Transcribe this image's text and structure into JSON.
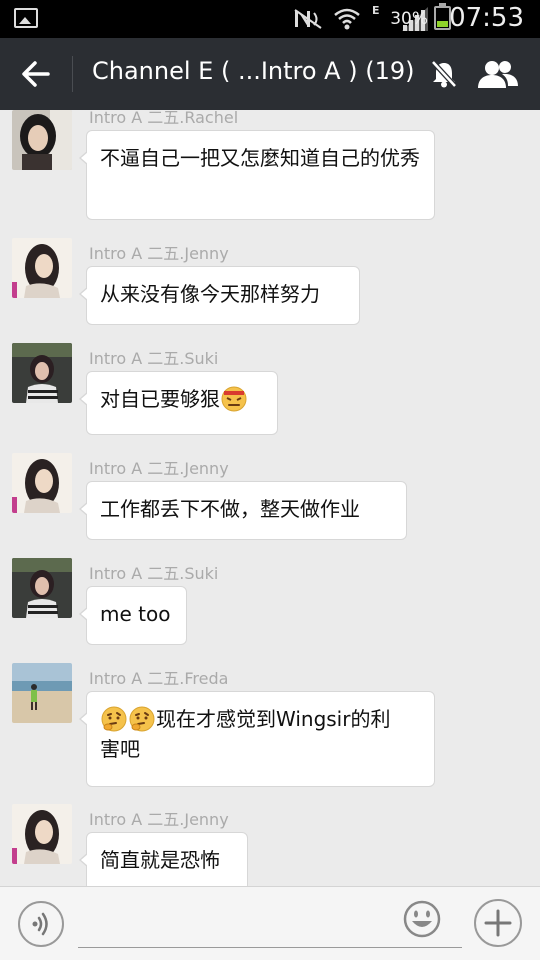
{
  "status_bar": {
    "battery": "30%",
    "network": "E",
    "time": "07:53",
    "battery_level": 0.3
  },
  "header": {
    "title": "Channel E ( ...Intro A ) (19)",
    "icons": [
      "back-arrow-icon",
      "mute-icon",
      "members-icon"
    ]
  },
  "messages": [
    {
      "sender": "Intro A 二五.Rachel",
      "text": "不逼自己一把又怎麼知道自己的优秀",
      "emoji": [],
      "avatar": "rachel"
    },
    {
      "sender": "Intro A 二五.Jenny",
      "text": "从来没有像今天那样努力",
      "emoji": [],
      "avatar": "jenny"
    },
    {
      "sender": "Intro A 二五.Suki",
      "text": "对自已要够狠",
      "emoji": [
        "determined-face-emoji"
      ],
      "avatar": "suki"
    },
    {
      "sender": "Intro A 二五.Jenny",
      "text": "工作都丢下不做，整天做作业",
      "emoji": [],
      "avatar": "jenny"
    },
    {
      "sender": "Intro A 二五.Suki",
      "text": "me too",
      "emoji": [],
      "avatar": "suki"
    },
    {
      "sender": "Intro A 二五.Freda",
      "text_line1": "现在才感觉到Wingsir的利",
      "text_line2": "害吧",
      "emoji": [
        "thinking-face-emoji",
        "thinking-face-emoji"
      ],
      "avatar": "freda"
    },
    {
      "sender": "Intro A 二五.Jenny",
      "text": "简直就是恐怖",
      "emoji": [],
      "avatar": "jenny"
    }
  ],
  "input_bar": {
    "placeholder": "",
    "icons": [
      "voice-icon",
      "smiley-icon",
      "plus-icon"
    ]
  },
  "colors": {
    "header_bg": "#2b2e33",
    "chat_bg": "#ebebeb",
    "bubble_bg": "#ffffff",
    "sender_text": "#aaaaaa"
  }
}
